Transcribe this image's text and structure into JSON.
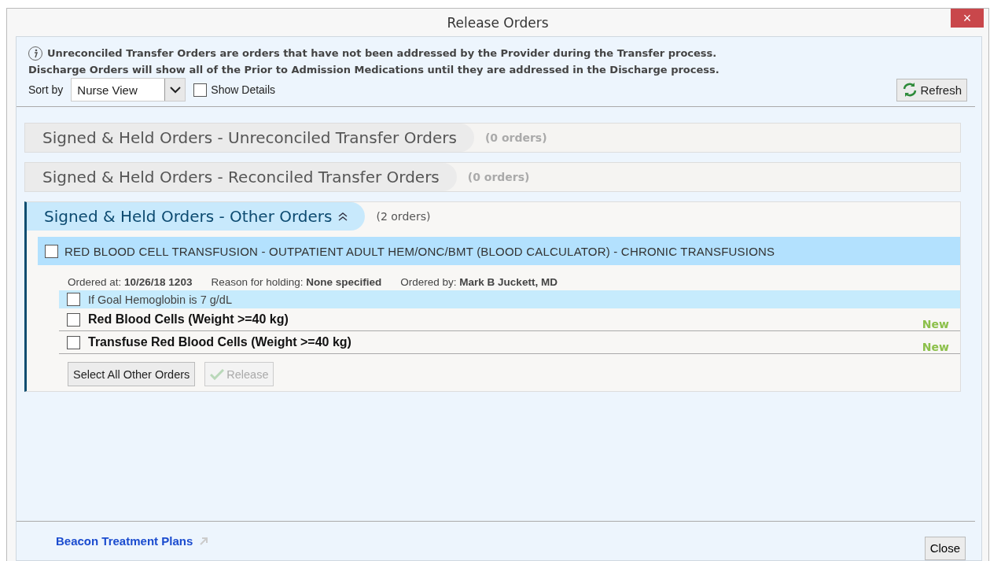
{
  "window": {
    "title": "Release Orders",
    "close": "×"
  },
  "info": {
    "lines": [
      "Unreconciled Transfer Orders are orders that have not been addressed by the Provider during the Transfer process.",
      "Discharge Orders will show all of the Prior to Admission Medications until they are addressed in the Discharge process."
    ]
  },
  "toolbar": {
    "sort_label": "Sort by",
    "sort_value": "Nurse View",
    "show_details": {
      "label": "Show Details",
      "checked": false
    },
    "refresh": "Refresh"
  },
  "sections": [
    {
      "title": "Signed & Held Orders - Unreconciled Transfer Orders",
      "count": "(0 orders)",
      "expanded": false
    },
    {
      "title": "Signed & Held Orders - Reconciled Transfer Orders",
      "count": "(0 orders)",
      "expanded": false
    },
    {
      "title": "Signed & Held Orders - Other Orders",
      "count": "(2 orders)",
      "expanded": true,
      "order": {
        "title": "RED BLOOD CELL TRANSFUSION - OUTPATIENT ADULT HEM/ONC/BMT (BLOOD CALCULATOR) - CHRONIC TRANSFUSIONS",
        "checked": false,
        "details": [
          {
            "label": "Ordered at:",
            "value": "10/26/18  1203"
          },
          {
            "label": "Reason for holding:",
            "value": "None specified"
          },
          {
            "label": "Ordered by:",
            "value": "Mark B Juckett, MD"
          }
        ],
        "items": [
          {
            "kind": "condition",
            "text": "If Goal Hemoglobin is 7 g/dL",
            "checked": false
          },
          {
            "kind": "order",
            "text": "Red Blood Cells (Weight >=40 kg)",
            "checked": false,
            "status": "New"
          },
          {
            "kind": "order",
            "text": "Transfuse Red Blood Cells (Weight >=40 kg)",
            "checked": false,
            "status": "New"
          }
        ]
      },
      "buttons": [
        {
          "label": "Select All Other Orders",
          "disabled": false
        },
        {
          "label": "Release",
          "disabled": true
        }
      ]
    }
  ],
  "footer": {
    "link": "Beacon Treatment Plans",
    "close": "Close"
  }
}
